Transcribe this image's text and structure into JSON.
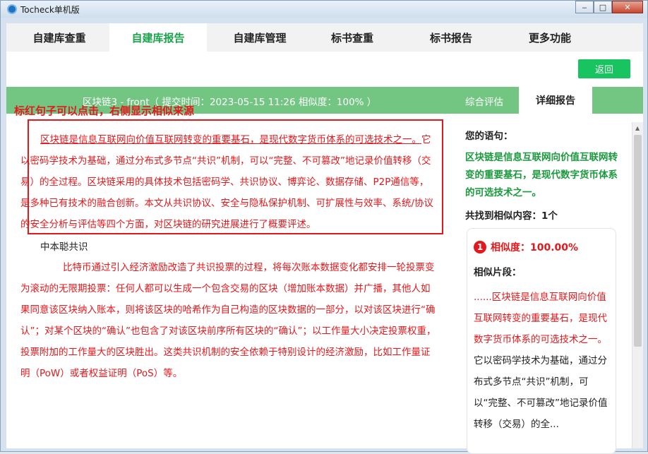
{
  "window": {
    "title": "Tocheck单机版",
    "minimize": "‒",
    "maximize": "□",
    "close": "✕"
  },
  "tabs": [
    {
      "label": "自建库查重"
    },
    {
      "label": "自建库报告"
    },
    {
      "label": "自建库管理"
    },
    {
      "label": "标书查重"
    },
    {
      "label": "标书报告"
    },
    {
      "label": "更多功能"
    }
  ],
  "back_label": "返回",
  "report_bar": {
    "info": "区块链3 - front（ 提交时间：2023-05-15 11:26 相似度：100% ）",
    "summary_tab": "综合评估",
    "detail_tab": "详细报告"
  },
  "hint": "标红句子可以点击，右侧显示相似来源",
  "document": {
    "para1_highlight": "区块链是信息互联网向价值互联网转变的重要基石，是现代数字货币体系的可选技术之一。",
    "para1_rest": "它以密码学技术为基础，通过分布式多节点“共识”机制，可以“完整、不可篡改”地记录价值转移（交易）的全过程。区块链采用的具体技术包括密码学、共识协议、博弈论、数据存储、P2P通信等，是多种已有技术的融合创新。本文从共识协议、安全与隐私保护机制、可扩展性与效率、系统/协议的安全分析与评估等四个方面，对区块链的研究进展进行了概要评述。",
    "author": "中本聪共识",
    "para2": "比特币通过引入经济激励改造了共识投票的过程，将每次账本数据变化都安排一轮投票变为滚动的无限期投票：任何人都可以生成一个包含交易的区块（增加账本数据）并广播，其他人如果同意该区块纳入账本，则将该区块的哈希作为自己构造的区块数据的一部分，以对该区块进行“确认”；对某个区块的“确认”也包含了对该区块前序所有区块的“确认”；以工作量大小决定投票权重，投票附加的工作量大的区块胜出。这类共识机制的安全依赖于特别设计的经济激励，比如工作量证明（PoW）或者权益证明（PoS）等。"
  },
  "side": {
    "your_sentence_label": "您的语句：",
    "your_sentence": "区块链是信息互联网向价值互联网转变的重要基石，是现代数字货币体系的可选技术之一。",
    "found_label": "共找到相似内容：1个",
    "result_index": "1",
    "similarity": "相似度：100.00%",
    "fragment_label": "相似片段：",
    "fragment_red": "......区块链是信息互联网向价值互联网转变的重要基石，是现代数字货币体系的可选技术之一。",
    "fragment_black": "它以密码学技术为基础，通过分布式多节点“共识”机制，可以“完整、不可篡改”地记录价值转移（交易）的全..."
  },
  "colors": {
    "accent_green": "#1aa34a",
    "bar_green": "#72c682",
    "button_green": "#17c45f",
    "highlight_red": "#e3181c"
  }
}
